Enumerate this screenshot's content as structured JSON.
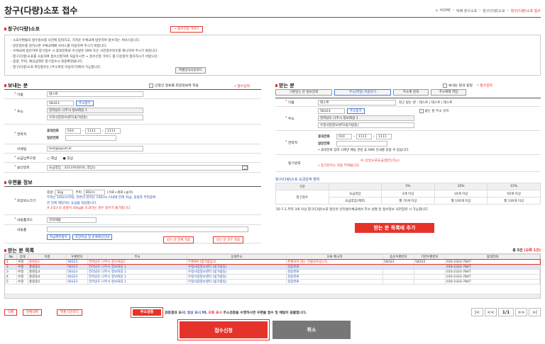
{
  "page_title": "창구(다량)소포 접수",
  "breadcrumb": [
    "HOME",
    "택배·창구소포",
    "창구(다량)소포",
    "창구(다량)소포 접수"
  ],
  "guide": {
    "title": "창구(다량)소포",
    "guide_btn": "→ 접수신청 가이드",
    "items": [
      "소포우편물의 접수정보를 사전에 입력하고, 가까운 우체국에 방문하여 접수하는 서비스입니다.",
      "방문접수를 원하시면 우체국택배 서비스를 이용하여 주시기 바랍니다.",
      "우체국에 방문하여 창구접수 시 휴대전화로 수신받은 SMS 또는 사전접수번호를 제시하여 주시기 바랍니다.",
      "창구(다량)소포를 사용하여 접수신청하여 처음이시면 → 접수신청 가이드 를 다운받아 참조하시기 바랍니다.",
      "중량, 부피, 예상금액은 창구접수시 최종확정됩니다.",
      "창구(다량)소포 파일접수는 [주소파일 이용하기]에서 가능합니다."
    ],
    "excel_btn": "엑셀양식다운로드"
  },
  "sender": {
    "title": "보내는 분",
    "save_check": "신청인 정보를 회원정보에 적용",
    "required": "• 필수입력",
    "name_label": "이름",
    "name": "테스트",
    "addr_label": "주소",
    "zip": "58323",
    "find_btn": "주소찾기",
    "addr1": "전라남도 나주시 정보화길 1",
    "addr2": "우정사업정보센터(빛가람동)",
    "phone_label": "연락처",
    "mobile_label": "휴대전화",
    "mobile": [
      "010",
      "1111",
      "1111"
    ],
    "tel_label": "일반전화",
    "email_label": "이메일",
    "email": "test@epost.kr",
    "pay_label": "요금납부구분",
    "pay_opts": [
      "즉납",
      "후납"
    ],
    "approval_label": "승인번호",
    "approval": "요금후납 : 3211910010, 후납()"
  },
  "receiver": {
    "title": "받는 분",
    "same_check": "보내는 분과 동일",
    "required": "• 필수입력",
    "tabs": [
      "기존받는 분 정보검색",
      "주소(파일) 이용하기",
      "주소록 검색",
      "주소록에 저장"
    ],
    "name_label": "이름",
    "name": "테스트",
    "recent_label": "최근 받는 분 : 테스트 | 테스트 | 테스트",
    "addr_label": "주소",
    "zip": "58323",
    "find_btn": "주소찾기",
    "ship_check": "받는 분 주소 유지",
    "addr1": "전라남도 나주시 정보화길 1",
    "addr2": "우정사업정보센터(빛가람동)",
    "phone_label": "연락처",
    "mobile_label": "휴대전화",
    "mobile": [
      "010",
      "1111",
      "1111"
    ],
    "tel_label": "일반전화",
    "phone_note": "• 휴대전화 입력 시에만 배송 관련 휴 SMS 안내를 받을 수 있습니다.",
    "proof_label": "등기번호",
    "proof_note1": "※ (선납소포요금(할인)가능)",
    "proof_note2": "• 등기번호는 자동 부여됩니다."
  },
  "parcel": {
    "title": "우편물 정보",
    "content_label": "포장박스크기",
    "weight_label": "중량",
    "weight": "3kg",
    "vol_label": "부피",
    "vol": "80cm",
    "vol_note": "(가로+세로+높이)",
    "note1": "부피는 160cm이내, 한변의 길이는 100cm 이내에 한해 취급, 중량과 부피중에",
    "note2": "큰 것에 해당하는 요금을 적용합니다.",
    "note3": "※ 1덕스의 중량이 30kg을 초과하는 경우 접수가 불가합니다.",
    "type_label": "내용품코드",
    "type_val": "전자제품",
    "desc_label": "내용품",
    "btn1": "취급제한품목",
    "btn2": "포장취급 및 손해배상안내"
  },
  "rate": {
    "title": "창구(다량)소포 요금감액 범위",
    "headers": [
      "구분",
      "5%",
      "10%",
      "15%"
    ],
    "row_head": "창구접수",
    "rows": [
      [
        "요금즉납",
        "3개 이상",
        "10개 이상",
        "50개 이상"
      ],
      [
        "요금후납(계약)",
        "월 70개 이상",
        "월 100개 이상",
        "월 130개 이상"
      ]
    ],
    "note": "'20.7.1.부터 3개 이상 창구(다량)소포 할인은 인터넷우체국에서 추소·성명 등 접수정보 사전입력 시 가능합니다.",
    "add_btn": "받는 분 목록에 추가"
  },
  "mid_btns": [
    "받는 분 전체 적용",
    "받는 분 모두 적용"
  ],
  "list": {
    "title": "받는 분 목록",
    "count_label": "총 5건",
    "count_red": "(오류 1건)",
    "headers": [
      "No",
      "상태",
      "이름",
      "우편번호",
      "주소",
      "상세주소",
      "오류 메시지",
      "승순우편번호",
      "기관우편번호",
      "휴대전화"
    ],
    "rows": [
      [
        "1",
        "수정",
        "홍원동1",
        "58323",
        "전라남도 나주시 중도화길2",
        "두편SM (빛가람동)2",
        "존재하지 않는 건물번호입니다.",
        "58323",
        "58322",
        "010-2323-7847"
      ],
      [
        "2",
        "수정",
        "홍원동2",
        "58323",
        "전라남도 나주시 정보화길 1",
        "우정사업정보센터 (빛가람동)",
        "검증완료",
        "",
        "",
        "010-2323-7847"
      ],
      [
        "3",
        "수정",
        "홍원동3",
        "58323",
        "전라남도 나주시 정보화길 1",
        "우정사업정보센터 (빛가람동)",
        "검증완료",
        "",
        "",
        "010-2323-7847"
      ],
      [
        "4",
        "수정",
        "홍원동4",
        "58323",
        "전라남도 나주시 정보화길 1",
        "우정사업정보센터 (빛가람동)",
        "검증완료",
        "",
        "",
        "010-2323-7847"
      ],
      [
        "5",
        "수정",
        "홍원동5",
        "58323",
        "전라남도 나주시 정보화길 1",
        "우정사업정보센터 (빛가람동)",
        "검증완료",
        "",
        "",
        "010-2323-7847"
      ]
    ]
  },
  "bottom": {
    "delete": "삭제",
    "delete_all": "전체삭제",
    "excel": "엑셀 다운로드",
    "verify": "주소검증",
    "verify_note": "검증결과 표시:",
    "ok_label": "정상 표시 HL",
    "err_label": "오류 표시",
    "verify_note2": "주소검증을 수행하시면 우편물 접수 및 배달이 원활합니다.",
    "page": "1/1"
  },
  "submit": "접수신청",
  "cancel": "취소"
}
